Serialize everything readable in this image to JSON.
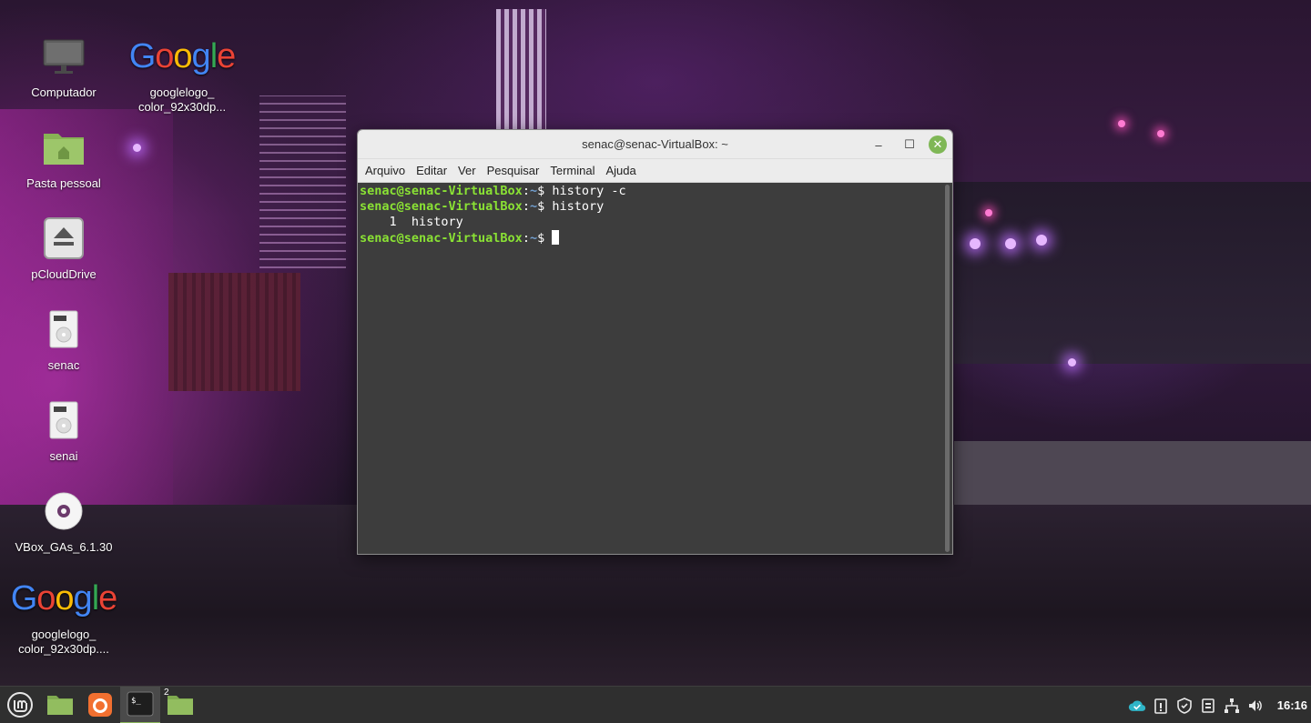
{
  "desktop": {
    "icons": [
      {
        "label": "Computador"
      },
      {
        "label": "googlelogo_\ncolor_92x30dp..."
      },
      {
        "label": "Pasta pessoal"
      },
      {
        "label": "pCloudDrive"
      },
      {
        "label": "senac"
      },
      {
        "label": "senai"
      },
      {
        "label": "VBox_GAs_6.1.30"
      },
      {
        "label": "googlelogo_\ncolor_92x30dp...."
      }
    ],
    "google_logo_text": {
      "g1": "G",
      "o1": "o",
      "o2": "o",
      "g2": "g",
      "l": "l",
      "e": "e"
    }
  },
  "terminal": {
    "title": "senac@senac-VirtualBox: ~",
    "menu": [
      "Arquivo",
      "Editar",
      "Ver",
      "Pesquisar",
      "Terminal",
      "Ajuda"
    ],
    "lines": [
      {
        "user": "senac@senac-VirtualBox",
        "sep": ":",
        "path": "~",
        "prompt": "$ ",
        "cmd": "history -c"
      },
      {
        "user": "senac@senac-VirtualBox",
        "sep": ":",
        "path": "~",
        "prompt": "$ ",
        "cmd": "history"
      },
      {
        "output": "    1  history"
      },
      {
        "user": "senac@senac-VirtualBox",
        "sep": ":",
        "path": "~",
        "prompt": "$ ",
        "cmd": ""
      }
    ],
    "controls": {
      "minimize": "‒",
      "maximize": "☐",
      "close": "✕"
    }
  },
  "taskbar": {
    "workspace_badge": "2",
    "terminal_glyph": "$_",
    "clock": "16:16"
  },
  "colors": {
    "prompt_user": "#8ae234",
    "prompt_path": "#729fcf",
    "accent_green": "#7fb756"
  }
}
